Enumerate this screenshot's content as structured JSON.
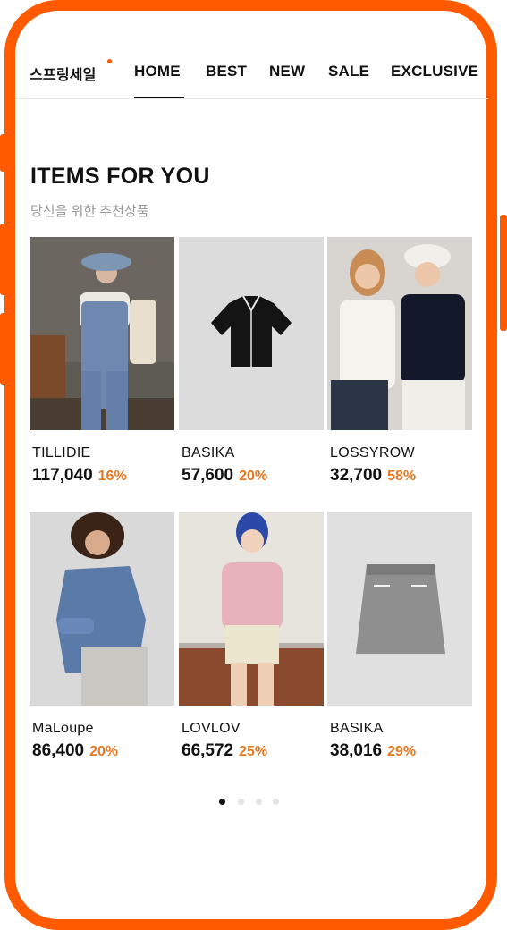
{
  "nav": {
    "brand": "스프링세일",
    "items": [
      "HOME",
      "BEST",
      "NEW",
      "SALE",
      "EXCLUSIVE"
    ],
    "active_index": 0
  },
  "section": {
    "title": "ITEMS FOR YOU",
    "subtitle": "당신을 위한 추천상품"
  },
  "products": [
    {
      "brand": "TILLIDIE",
      "price": "117,040",
      "discount": "16%"
    },
    {
      "brand": "BASIKA",
      "price": "57,600",
      "discount": "20%"
    },
    {
      "brand": "LOSSYROW",
      "price": "32,700",
      "discount": "58%"
    },
    {
      "brand": "MaLoupe",
      "price": "86,400",
      "discount": "20%"
    },
    {
      "brand": "LOVLOV",
      "price": "66,572",
      "discount": "25%"
    },
    {
      "brand": "BASIKA",
      "price": "38,016",
      "discount": "29%"
    }
  ],
  "pagination": {
    "count": 4,
    "active": 0
  },
  "colors": {
    "accent": "#ff5a00",
    "discount": "#e87722"
  }
}
